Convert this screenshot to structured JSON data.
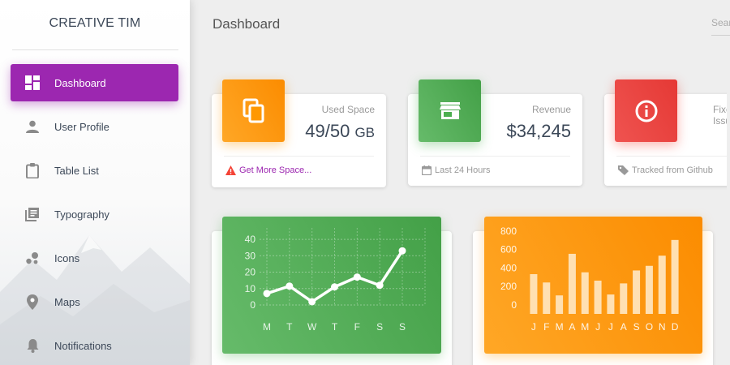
{
  "brand": {
    "name": "CREATIVE TIM"
  },
  "sidebar": {
    "items": [
      {
        "label": "Dashboard",
        "icon": "dashboard-icon",
        "active": true
      },
      {
        "label": "User Profile",
        "icon": "person-icon",
        "active": false
      },
      {
        "label": "Table List",
        "icon": "clipboard-icon",
        "active": false
      },
      {
        "label": "Typography",
        "icon": "library-books-icon",
        "active": false
      },
      {
        "label": "Icons",
        "icon": "bubbles-icon",
        "active": false
      },
      {
        "label": "Maps",
        "icon": "location-pin-icon",
        "active": false
      },
      {
        "label": "Notifications",
        "icon": "bell-icon",
        "active": false
      }
    ]
  },
  "header": {
    "title": "Dashboard",
    "search_placeholder": "Search"
  },
  "stats": [
    {
      "category": "Used Space",
      "value": "49/50",
      "unit": "GB",
      "icon": "copy-icon",
      "color": "#ff9800",
      "footer": "Get More Space...",
      "footer_icon": "warning-icon",
      "footer_color": "#9c27b0",
      "footer_icon_color": "#f44336"
    },
    {
      "category": "Revenue",
      "value": "$34,245",
      "unit": "",
      "icon": "store-icon",
      "color": "#4caf50",
      "footer": "Last 24 Hours",
      "footer_icon": "calendar-icon"
    },
    {
      "category": "Fixed Issues",
      "value": "",
      "unit": "",
      "icon": "info-icon",
      "color": "#f44336",
      "footer": "Tracked from Github",
      "footer_icon": "tag-icon"
    }
  ],
  "chart_data": [
    {
      "type": "line",
      "categories": [
        "M",
        "T",
        "W",
        "T",
        "F",
        "S",
        "S"
      ],
      "values": [
        7,
        11.5,
        2,
        11,
        17,
        12,
        33
      ],
      "yticks": [
        0,
        10,
        20,
        30,
        40
      ],
      "ylim": [
        0,
        43
      ],
      "grid": true,
      "color": "#ffffff",
      "background": "#4caf50"
    },
    {
      "type": "bar",
      "categories": [
        "J",
        "F",
        "M",
        "A",
        "M",
        "J",
        "J",
        "A",
        "S",
        "O",
        "N",
        "D"
      ],
      "values": [
        430,
        340,
        200,
        650,
        450,
        360,
        210,
        330,
        470,
        520,
        630,
        800
      ],
      "yticks": [
        0,
        200,
        400,
        600,
        800
      ],
      "ylim": [
        0,
        860
      ],
      "grid": false,
      "color": "#ffe0b2",
      "background": "#ff9800"
    }
  ]
}
